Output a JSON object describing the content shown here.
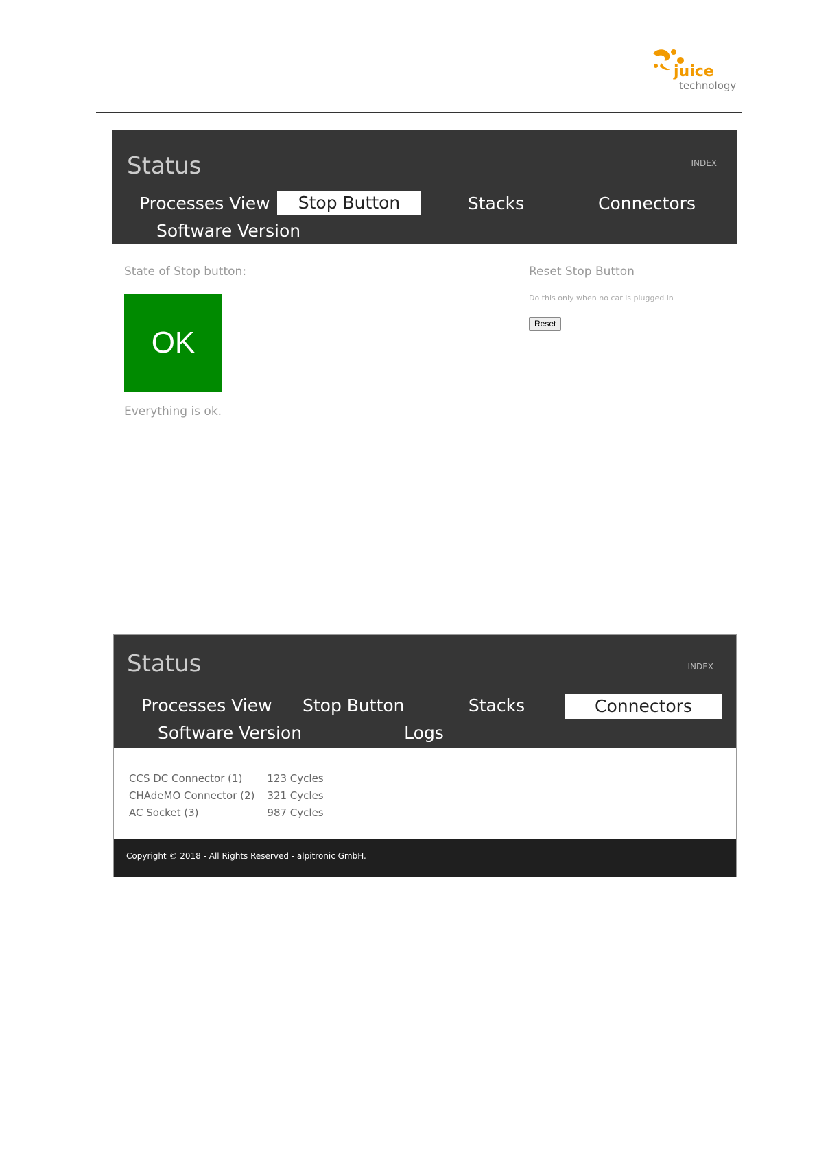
{
  "logo": {
    "line1": "juice",
    "line2": "technology",
    "brand_color": "#f29a00"
  },
  "screen1": {
    "title": "Status",
    "index_link": "INDEX",
    "nav": [
      {
        "label": "Processes View",
        "active": false
      },
      {
        "label": "Stop Button",
        "active": true
      },
      {
        "label": "Stacks",
        "active": false
      },
      {
        "label": "Connectors",
        "active": false
      },
      {
        "label": "Software Version",
        "active": false
      }
    ],
    "state_label": "State of Stop button:",
    "state_value": "OK",
    "state_color": "#008a00",
    "state_message": "Everything is ok.",
    "reset": {
      "title": "Reset Stop Button",
      "hint": "Do this only when no car is plugged in",
      "button_label": "Reset"
    }
  },
  "screen2": {
    "title": "Status",
    "index_link": "INDEX",
    "nav": [
      {
        "label": "Processes View",
        "active": false
      },
      {
        "label": "Stop Button",
        "active": false
      },
      {
        "label": "Stacks",
        "active": false
      },
      {
        "label": "Connectors",
        "active": true
      },
      {
        "label": "Software Version",
        "active": false
      },
      {
        "label": "Logs",
        "active": false
      }
    ],
    "connectors": [
      {
        "name": "CCS DC Connector (1)",
        "cycles": "123 Cycles"
      },
      {
        "name": "CHAdeMO Connector (2)",
        "cycles": "321 Cycles"
      },
      {
        "name": "AC Socket (3)",
        "cycles": "987 Cycles"
      }
    ],
    "footer": "Copyright © 2018 - All Rights Reserved - alpitronic GmbH."
  }
}
